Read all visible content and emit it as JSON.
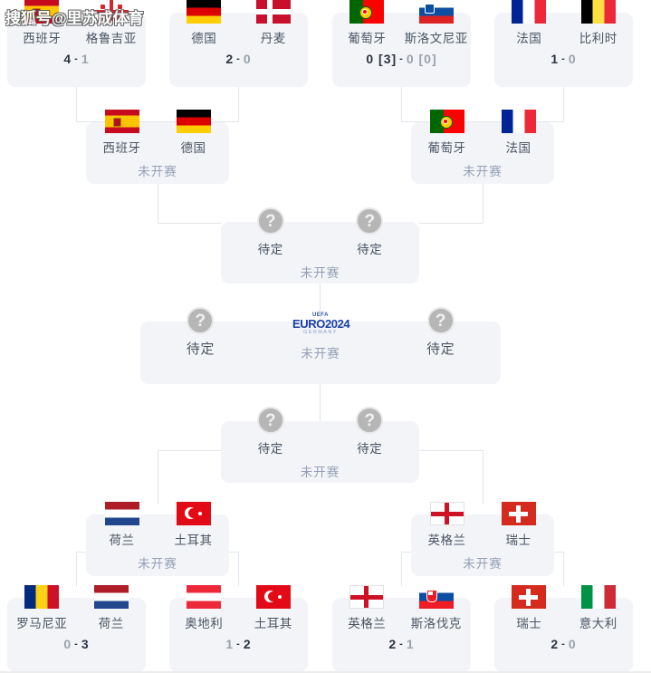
{
  "watermark": {
    "text": "搜狐号@里苏成体育"
  },
  "labels": {
    "not_started": "未开赛",
    "tbd": "待定",
    "tbd_icon": "question-mark-icon",
    "score_separator": "-"
  },
  "logo": {
    "arc": "UEFA",
    "main": "EURO2024",
    "sub": "GERMANY"
  },
  "rounds": [
    {
      "name": "round-of-16-top",
      "matches": [
        {
          "id": "r16-1",
          "home": {
            "name": "西班牙",
            "flag": "es",
            "score": "4",
            "winner": true
          },
          "away": {
            "name": "格鲁吉亚",
            "flag": "ge",
            "score": "1",
            "winner": false
          },
          "status": ""
        },
        {
          "id": "r16-2",
          "home": {
            "name": "德国",
            "flag": "de",
            "score": "2",
            "winner": true
          },
          "away": {
            "name": "丹麦",
            "flag": "dk",
            "score": "0",
            "winner": false
          },
          "status": ""
        },
        {
          "id": "r16-3",
          "home": {
            "name": "葡萄牙",
            "flag": "pt",
            "score": "0 [3]",
            "winner": true
          },
          "away": {
            "name": "斯洛文尼亚",
            "flag": "si",
            "score": "0 [0]",
            "winner": false
          },
          "status": ""
        },
        {
          "id": "r16-4",
          "home": {
            "name": "法国",
            "flag": "fr",
            "score": "1",
            "winner": true
          },
          "away": {
            "name": "比利时",
            "flag": "be",
            "score": "0",
            "winner": false
          },
          "status": ""
        }
      ]
    },
    {
      "name": "quarterfinals-top",
      "matches": [
        {
          "id": "qf-1",
          "home": {
            "name": "西班牙",
            "flag": "es"
          },
          "away": {
            "name": "德国",
            "flag": "de"
          },
          "status": "未开赛"
        },
        {
          "id": "qf-2",
          "home": {
            "name": "葡萄牙",
            "flag": "pt"
          },
          "away": {
            "name": "法国",
            "flag": "fr"
          },
          "status": "未开赛"
        }
      ]
    },
    {
      "name": "semifinal-top",
      "matches": [
        {
          "id": "sf-1",
          "home": {
            "name": "待定",
            "flag": "tbd"
          },
          "away": {
            "name": "待定",
            "flag": "tbd"
          },
          "status": "未开赛"
        }
      ]
    },
    {
      "name": "final",
      "matches": [
        {
          "id": "final",
          "home": {
            "name": "待定",
            "flag": "tbd"
          },
          "away": {
            "name": "待定",
            "flag": "tbd"
          },
          "status": "未开赛"
        }
      ]
    },
    {
      "name": "semifinal-bottom",
      "matches": [
        {
          "id": "sf-2",
          "home": {
            "name": "待定",
            "flag": "tbd"
          },
          "away": {
            "name": "待定",
            "flag": "tbd"
          },
          "status": "未开赛"
        }
      ]
    },
    {
      "name": "quarterfinals-bottom",
      "matches": [
        {
          "id": "qf-3",
          "home": {
            "name": "荷兰",
            "flag": "nl"
          },
          "away": {
            "name": "土耳其",
            "flag": "tr"
          },
          "status": "未开赛"
        },
        {
          "id": "qf-4",
          "home": {
            "name": "英格兰",
            "flag": "en"
          },
          "away": {
            "name": "瑞士",
            "flag": "ch"
          },
          "status": "未开赛"
        }
      ]
    },
    {
      "name": "round-of-16-bottom",
      "matches": [
        {
          "id": "r16-5",
          "home": {
            "name": "罗马尼亚",
            "flag": "ro",
            "score": "0",
            "winner": false
          },
          "away": {
            "name": "荷兰",
            "flag": "nl",
            "score": "3",
            "winner": true
          },
          "status": ""
        },
        {
          "id": "r16-6",
          "home": {
            "name": "奥地利",
            "flag": "at",
            "score": "1",
            "winner": false
          },
          "away": {
            "name": "土耳其",
            "flag": "tr",
            "score": "2",
            "winner": true
          },
          "status": ""
        },
        {
          "id": "r16-7",
          "home": {
            "name": "英格兰",
            "flag": "en",
            "score": "2",
            "winner": true
          },
          "away": {
            "name": "斯洛伐克",
            "flag": "sk",
            "score": "1",
            "winner": false
          },
          "status": ""
        },
        {
          "id": "r16-8",
          "home": {
            "name": "瑞士",
            "flag": "ch",
            "score": "2",
            "winner": true
          },
          "away": {
            "name": "意大利",
            "flag": "it",
            "score": "0",
            "winner": false
          },
          "status": ""
        }
      ]
    }
  ]
}
